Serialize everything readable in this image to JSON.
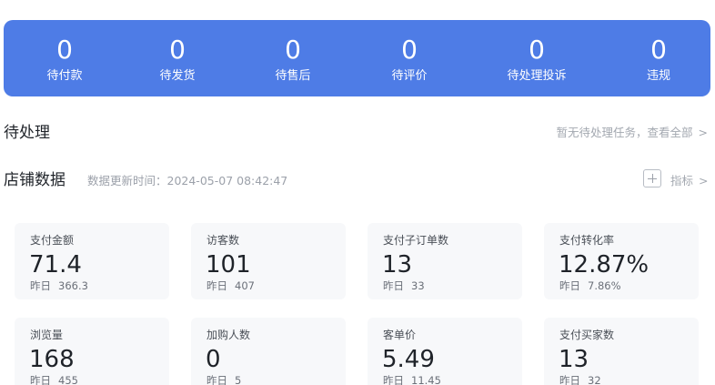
{
  "status_bar": {
    "items": [
      {
        "count": "0",
        "label": "待付款"
      },
      {
        "count": "0",
        "label": "待发货"
      },
      {
        "count": "0",
        "label": "待售后"
      },
      {
        "count": "0",
        "label": "待评价"
      },
      {
        "count": "0",
        "label": "待处理投诉"
      },
      {
        "count": "0",
        "label": "违规"
      }
    ]
  },
  "pending": {
    "title": "待处理",
    "link_text": "暂无待处理任务，查看全部",
    "chevron": ">"
  },
  "store_data": {
    "title": "店铺数据",
    "update_time": "数据更新时间：2024-05-07 08:42:47",
    "metrics_link": "指标",
    "chevron": ">",
    "cards": [
      {
        "label": "支付金额",
        "value": "71.4",
        "prev_label": "昨日",
        "prev_value": "366.3"
      },
      {
        "label": "访客数",
        "value": "101",
        "prev_label": "昨日",
        "prev_value": "407"
      },
      {
        "label": "支付子订单数",
        "value": "13",
        "prev_label": "昨日",
        "prev_value": "33"
      },
      {
        "label": "支付转化率",
        "value": "12.87%",
        "prev_label": "昨日",
        "prev_value": "7.86%"
      },
      {
        "label": "浏览量",
        "value": "168",
        "prev_label": "昨日",
        "prev_value": "455"
      },
      {
        "label": "加购人数",
        "value": "0",
        "prev_label": "昨日",
        "prev_value": "5"
      },
      {
        "label": "客单价",
        "value": "5.49",
        "prev_label": "昨日",
        "prev_value": "11.45"
      },
      {
        "label": "支付买家数",
        "value": "13",
        "prev_label": "昨日",
        "prev_value": "32"
      }
    ]
  },
  "colors": {
    "accent": "#4e7ce6",
    "card_bg": "#f7f8fa",
    "muted_text": "#a3a8b0"
  },
  "icons": [
    "plus-square-icon",
    "chevron-right-icon"
  ]
}
